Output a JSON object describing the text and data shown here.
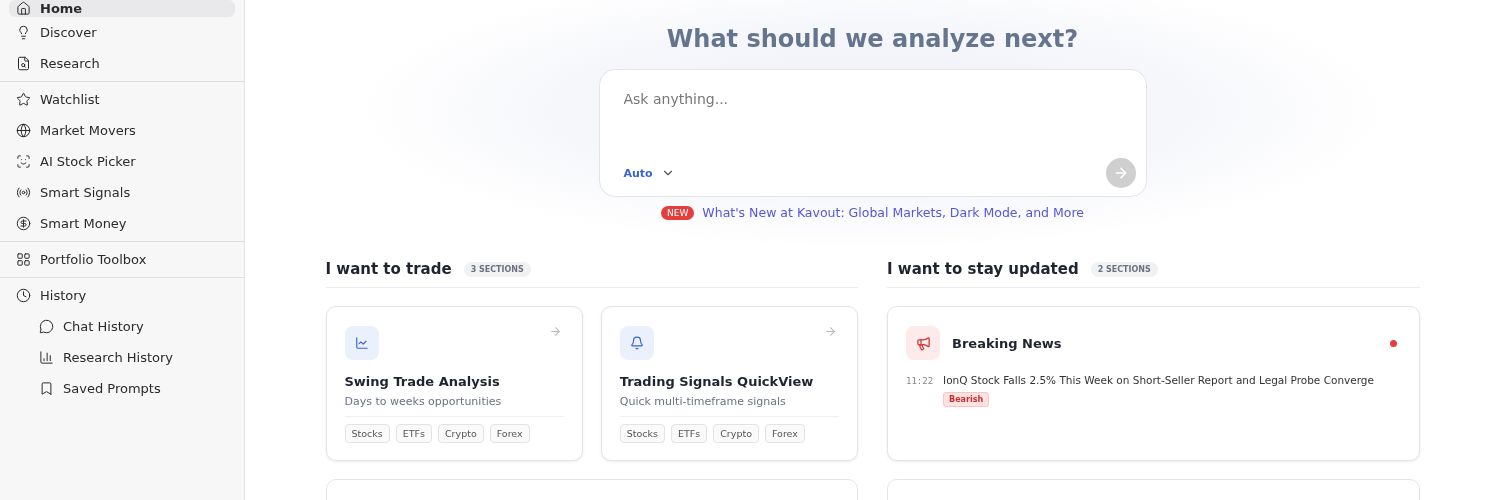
{
  "sidebar": {
    "groups": [
      {
        "items": [
          {
            "label": "Home",
            "selected": true
          },
          {
            "label": "Discover",
            "selected": false
          },
          {
            "label": "Research",
            "selected": false
          }
        ]
      },
      {
        "items": [
          {
            "label": "Watchlist",
            "selected": false
          },
          {
            "label": "Market Movers",
            "selected": false
          },
          {
            "label": "AI Stock Picker",
            "selected": false
          },
          {
            "label": "Smart Signals",
            "selected": false
          },
          {
            "label": "Smart Money",
            "selected": false
          }
        ]
      },
      {
        "items": [
          {
            "label": "Portfolio Toolbox",
            "selected": false
          }
        ]
      },
      {
        "items": [
          {
            "label": "History",
            "selected": false,
            "children": [
              {
                "label": "Chat History",
                "selected": false
              },
              {
                "label": "Research History",
                "selected": false
              },
              {
                "label": "Saved Prompts",
                "selected": false
              }
            ]
          }
        ]
      }
    ]
  },
  "hero": {
    "title": "What should we analyze next?",
    "prompt": {
      "placeholder": "Ask anything...",
      "mode": "Auto"
    },
    "announcement": {
      "badge": "NEW",
      "link": "What's New at Kavout: Global Markets, Dark Mode, and More"
    }
  },
  "sections": [
    {
      "title": "I want to trade",
      "count": "3 SECTIONS",
      "cards": [
        {
          "kind": "tool",
          "title": "Swing Trade Analysis",
          "subtitle": "Days to weeks opportunities",
          "tags": [
            "Stocks",
            "ETFs",
            "Crypto",
            "Forex"
          ]
        },
        {
          "kind": "tool",
          "title": "Trading Signals QuickView",
          "subtitle": "Quick multi-timeframe signals",
          "tags": [
            "Stocks",
            "ETFs",
            "Crypto",
            "Forex"
          ]
        }
      ]
    },
    {
      "title": "I want to stay updated",
      "count": "2 SECTIONS",
      "cards": [
        {
          "kind": "news",
          "title": "Breaking News",
          "live": true,
          "items": [
            {
              "time": "11:22",
              "headline": "IonQ Stock Falls 2.5% This Week on Short-Seller Report and Legal Probe Converge",
              "sentiment": "Bearish"
            }
          ]
        }
      ]
    }
  ]
}
